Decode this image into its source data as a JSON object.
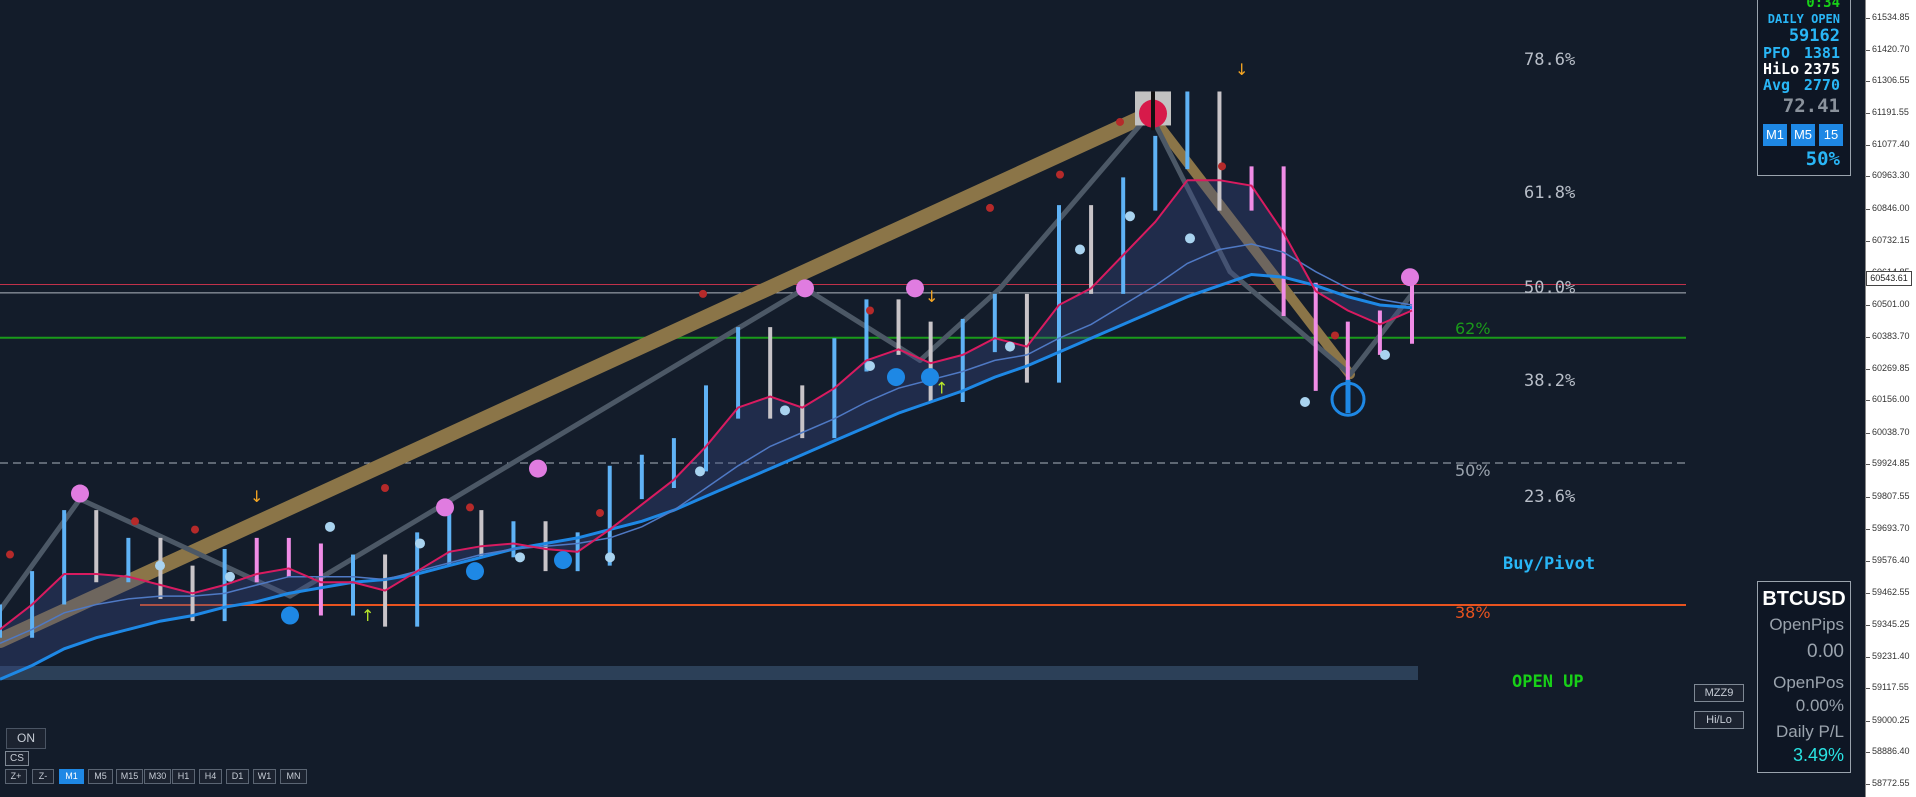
{
  "chart_data": {
    "type": "line",
    "title": "",
    "symbol": "BTCUSD",
    "timeframe": "M1",
    "ylim": [
      58772.55,
      61534.85
    ],
    "y_ticks": [
      "61534.85",
      "61420.70",
      "61306.55",
      "61191.55",
      "61077.40",
      "60963.30",
      "60846.00",
      "60732.15",
      "60614.85",
      "60501.00",
      "60383.70",
      "60269.85",
      "60156.00",
      "60038.70",
      "59924.85",
      "59807.55",
      "59693.70",
      "59576.40",
      "59462.55",
      "59345.25",
      "59231.40",
      "59117.55",
      "59000.25",
      "58886.40",
      "58772.55"
    ],
    "current_price": "60543.61",
    "series": [
      {
        "name": "price",
        "values": [
          59360,
          59480,
          59700,
          59560,
          59600,
          59500,
          59420,
          59560,
          59600,
          59580,
          59440,
          59540,
          59400,
          59620,
          59700,
          59650,
          59660,
          59600,
          59620,
          59860,
          59900,
          59960,
          60150,
          60360,
          60150,
          60080,
          60320,
          60460,
          60380,
          60210,
          60390,
          60480,
          60280,
          60800,
          60600,
          60900,
          61050,
          61210,
          60900,
          60940,
          60520,
          60250,
          60380,
          60420,
          60560
        ]
      },
      {
        "name": "fast_ma",
        "values": [
          59330,
          59420,
          59530,
          59530,
          59520,
          59490,
          59460,
          59490,
          59530,
          59550,
          59500,
          59500,
          59470,
          59540,
          59610,
          59630,
          59640,
          59620,
          59610,
          59690,
          59780,
          59870,
          59990,
          60130,
          60170,
          60130,
          60200,
          60300,
          60340,
          60290,
          60320,
          60380,
          60350,
          60500,
          60560,
          60680,
          60800,
          60950,
          60950,
          60930,
          60760,
          60550,
          60480,
          60430,
          60480
        ]
      },
      {
        "name": "slow_ma",
        "values": [
          59280,
          59330,
          59390,
          59420,
          59440,
          59450,
          59450,
          59460,
          59490,
          59520,
          59520,
          59520,
          59510,
          59540,
          59570,
          59600,
          59620,
          59630,
          59640,
          59660,
          59700,
          59760,
          59840,
          59920,
          59990,
          60040,
          60090,
          60150,
          60200,
          60230,
          60260,
          60300,
          60320,
          60380,
          60430,
          60500,
          60570,
          60650,
          60700,
          60720,
          60690,
          60620,
          60560,
          60520,
          60500
        ]
      },
      {
        "name": "trend_ma",
        "values": [
          59150,
          59200,
          59260,
          59300,
          59330,
          59360,
          59380,
          59410,
          59430,
          59460,
          59480,
          59500,
          59510,
          59530,
          59560,
          59590,
          59620,
          59640,
          59660,
          59690,
          59720,
          59760,
          59810,
          59860,
          59910,
          59960,
          60010,
          60060,
          60110,
          60150,
          60190,
          60240,
          60280,
          60330,
          60380,
          60430,
          60480,
          60530,
          60570,
          60610,
          60600,
          60570,
          60530,
          60500,
          60490
        ]
      },
      {
        "name": "zigzag",
        "values": [
          59400,
          59800,
          59450,
          60560,
          60300,
          60560,
          61190,
          60620,
          60250,
          60540
        ]
      }
    ],
    "fib_levels": [
      {
        "label": "78.6%",
        "value": 61342
      },
      {
        "label": "61.8%",
        "value": 60803
      },
      {
        "label": "50.0%",
        "value": 60422
      },
      {
        "label": "38.2%",
        "value": 60040
      },
      {
        "label": "23.6%",
        "value": 59567
      }
    ],
    "level_lines": [
      {
        "label": "62%",
        "value": 60382,
        "color": "#1a9a1a"
      },
      {
        "label": "50%",
        "value": 59930,
        "color": "#9aa3ad"
      },
      {
        "label": "38%",
        "value": 59418,
        "color": "#e8531f"
      }
    ],
    "annotations": [
      "Buy/Pivot",
      "OPEN UP"
    ],
    "grid": false
  },
  "info_panel": {
    "time": "0:34",
    "daily_open_label": "DAILY OPEN",
    "daily_open": "59162",
    "pfo_label": "PFO",
    "pfo": "1381",
    "hilo_label": "HiLo",
    "hilo": "2375",
    "avg_label": "Avg",
    "avg": "2770",
    "rsi": "72.41",
    "tf_buttons": [
      "M1",
      "M5",
      "15"
    ],
    "percent": "50%"
  },
  "account_panel": {
    "symbol": "BTCUSD",
    "open_pips_label": "OpenPips",
    "open_pips": "0.00",
    "open_pos_label": "OpenPos",
    "open_pos": "0.00%",
    "daily_pl_label": "Daily P/L",
    "daily_pl": "3.49%"
  },
  "buttons": {
    "mzz9": "MZZ9",
    "hilo": "Hi/Lo",
    "on": "ON",
    "cs": "CS"
  },
  "timeframe_bar": [
    "Z+",
    "Z-",
    "M1",
    "M5",
    "M15",
    "M30",
    "H1",
    "H4",
    "D1",
    "W1",
    "MN"
  ],
  "colors": {
    "background": "#131c2a",
    "bull": "#5fb2f5",
    "bear_pink": "#f08ce6",
    "fast_ma": "#d81b60",
    "trend_ma": "#1e88e5",
    "zigzag_main": "#8b7548",
    "zigzag_minor": "#4c5866",
    "accent_blue": "#29b6f6",
    "green_text": "#18d018"
  }
}
